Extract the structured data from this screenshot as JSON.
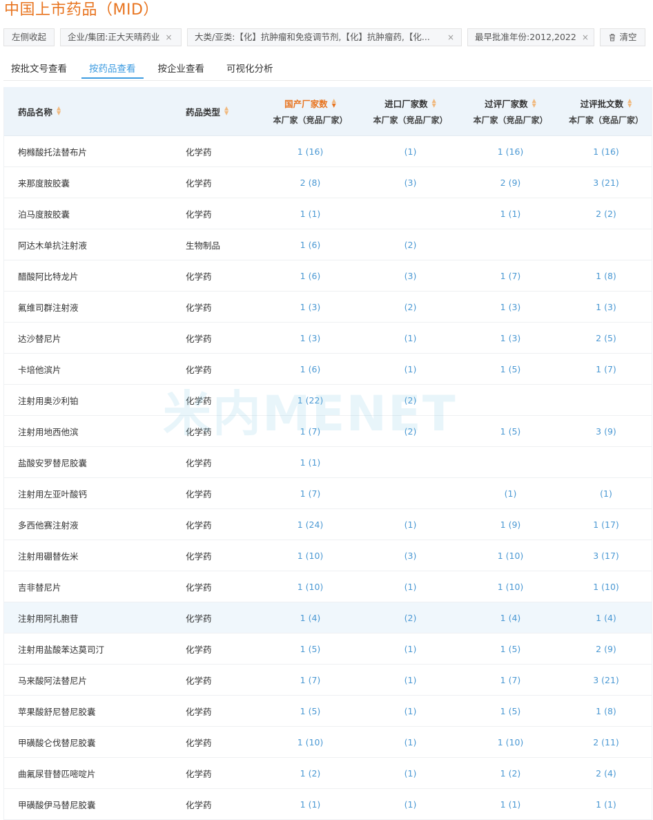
{
  "title": "中国上市药品（MID）",
  "filters": {
    "collapse": "左侧收起",
    "company": "企业/集团:正大天晴药业",
    "category": "大类/亚类:【化】抗肿瘤和免疫调节剂,【化】抗肿瘤药,【化...",
    "year": "最早批准年份:2012,2022",
    "clear": "清空",
    "close_glyph": "×"
  },
  "tabs": [
    {
      "label": "按批文号查看"
    },
    {
      "label": "按药品查看"
    },
    {
      "label": "按企业查看"
    },
    {
      "label": "可视化分析"
    }
  ],
  "watermark": "米内MENET",
  "columns": {
    "name": "药品名称",
    "type": "药品类型",
    "domestic": "国产厂家数",
    "imported": "进口厂家数",
    "evaluated": "过评厂家数",
    "evaluated_docs": "过评批文数",
    "sub": "本厂家（竞品厂家）"
  },
  "rows": [
    {
      "name": "枸橼酸托法替布片",
      "type": "化学药",
      "domestic": "1 (16)",
      "imported": "(1)",
      "evaluated": "1 (16)",
      "docs": "1 (16)"
    },
    {
      "name": "来那度胺胶囊",
      "type": "化学药",
      "domestic": "2 (8)",
      "imported": "(3)",
      "evaluated": "2 (9)",
      "docs": "3 (21)"
    },
    {
      "name": "泊马度胺胶囊",
      "type": "化学药",
      "domestic": "1 (1)",
      "imported": "",
      "evaluated": "1 (1)",
      "docs": "2 (2)"
    },
    {
      "name": "阿达木单抗注射液",
      "type": "生物制品",
      "domestic": "1 (6)",
      "imported": "(2)",
      "evaluated": "",
      "docs": ""
    },
    {
      "name": "醋酸阿比特龙片",
      "type": "化学药",
      "domestic": "1 (6)",
      "imported": "(3)",
      "evaluated": "1 (7)",
      "docs": "1 (8)"
    },
    {
      "name": "氟维司群注射液",
      "type": "化学药",
      "domestic": "1 (3)",
      "imported": "(2)",
      "evaluated": "1 (3)",
      "docs": "1 (3)"
    },
    {
      "name": "达沙替尼片",
      "type": "化学药",
      "domestic": "1 (3)",
      "imported": "(1)",
      "evaluated": "1 (3)",
      "docs": "2 (5)"
    },
    {
      "name": "卡培他滨片",
      "type": "化学药",
      "domestic": "1 (6)",
      "imported": "(1)",
      "evaluated": "1 (5)",
      "docs": "1 (7)"
    },
    {
      "name": "注射用奥沙利铂",
      "type": "化学药",
      "domestic": "1 (22)",
      "imported": "(2)",
      "evaluated": "",
      "docs": ""
    },
    {
      "name": "注射用地西他滨",
      "type": "化学药",
      "domestic": "1 (7)",
      "imported": "(2)",
      "evaluated": "1 (5)",
      "docs": "3 (9)"
    },
    {
      "name": "盐酸安罗替尼胶囊",
      "type": "化学药",
      "domestic": "1 (1)",
      "imported": "",
      "evaluated": "",
      "docs": ""
    },
    {
      "name": "注射用左亚叶酸钙",
      "type": "化学药",
      "domestic": "1 (7)",
      "imported": "",
      "evaluated": "(1)",
      "docs": "(1)"
    },
    {
      "name": "多西他赛注射液",
      "type": "化学药",
      "domestic": "1 (24)",
      "imported": "(1)",
      "evaluated": "1 (9)",
      "docs": "1 (17)"
    },
    {
      "name": "注射用硼替佐米",
      "type": "化学药",
      "domestic": "1 (10)",
      "imported": "(3)",
      "evaluated": "1 (10)",
      "docs": "3 (17)"
    },
    {
      "name": "吉非替尼片",
      "type": "化学药",
      "domestic": "1 (10)",
      "imported": "(1)",
      "evaluated": "1 (10)",
      "docs": "1 (10)"
    },
    {
      "name": "注射用阿扎胞苷",
      "type": "化学药",
      "domestic": "1 (4)",
      "imported": "(2)",
      "evaluated": "1 (4)",
      "docs": "1 (4)"
    },
    {
      "name": "注射用盐酸苯达莫司汀",
      "type": "化学药",
      "domestic": "1 (5)",
      "imported": "(1)",
      "evaluated": "1 (5)",
      "docs": "2 (9)"
    },
    {
      "name": "马来酸阿法替尼片",
      "type": "化学药",
      "domestic": "1 (7)",
      "imported": "(1)",
      "evaluated": "1 (7)",
      "docs": "3 (21)"
    },
    {
      "name": "苹果酸舒尼替尼胶囊",
      "type": "化学药",
      "domestic": "1 (5)",
      "imported": "(1)",
      "evaluated": "1 (5)",
      "docs": "1 (8)"
    },
    {
      "name": "甲磺酸仑伐替尼胶囊",
      "type": "化学药",
      "domestic": "1 (10)",
      "imported": "(1)",
      "evaluated": "1 (10)",
      "docs": "2 (11)"
    },
    {
      "name": "曲氟尿苷替匹嘧啶片",
      "type": "化学药",
      "domestic": "1 (2)",
      "imported": "(1)",
      "evaluated": "1 (2)",
      "docs": "2 (4)"
    },
    {
      "name": "甲磺酸伊马替尼胶囊",
      "type": "化学药",
      "domestic": "1 (1)",
      "imported": "(1)",
      "evaluated": "1 (1)",
      "docs": "1 (1)"
    }
  ]
}
